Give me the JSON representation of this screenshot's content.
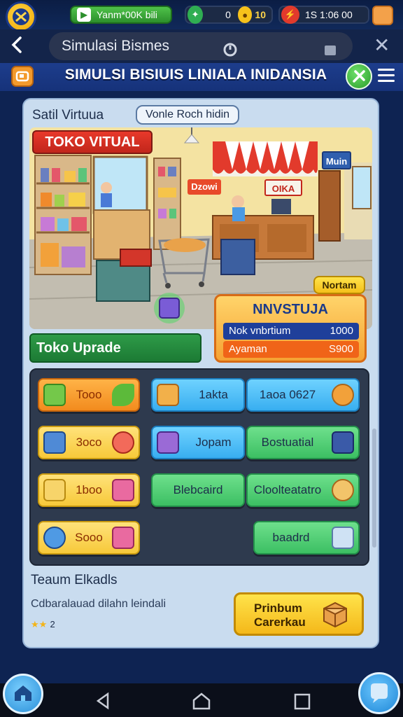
{
  "status": {
    "green_pill_text": "Yanm*00K bili",
    "coin_left": "0",
    "coin_value": "10",
    "time_text": "1S  1:06 00"
  },
  "addressbar": {
    "title": "Simulasi Bismes"
  },
  "header": {
    "title": "SIMULSI BISIUIS LINIALA INIDANSIA"
  },
  "scene": {
    "label": "Satil Virtuua",
    "chip": "Vonle Roch hidin",
    "banner": "TOKO VITUAL",
    "sign_left": "Dzowi",
    "sign_center": "OIKA",
    "sign_right": "Muin"
  },
  "invest": {
    "badge": "Nortam",
    "title": "NNVSTUJA",
    "row1_label": "Nok vnbrtium",
    "row1_value": "1000",
    "row2_label": "Ayaman",
    "row2_value": "S900"
  },
  "upgrade": {
    "title": "Toko Uprade"
  },
  "grid": {
    "buttons": [
      {
        "label": "Tooo"
      },
      {
        "label": "1akta"
      },
      {
        "label": "1aoa 0627"
      },
      {
        "label": "3oco"
      },
      {
        "label": "Jopam"
      },
      {
        "label": "Bostuatial"
      },
      {
        "label": "1boo"
      },
      {
        "label": "Blebcaird"
      },
      {
        "label": "Cloolteatatro"
      },
      {
        "label": "Sooo"
      },
      {
        "label": "baadrd"
      }
    ]
  },
  "tasks": {
    "title": "Teaum Elkadls",
    "description": "Cdbaralauad dilahn leindali",
    "rating": "2"
  },
  "premium": {
    "line1": "Prinbum",
    "line2": "Carerkau"
  }
}
